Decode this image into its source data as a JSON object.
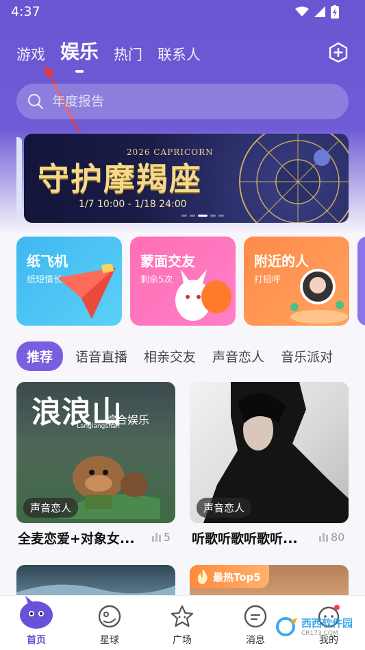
{
  "status": {
    "time": "4:37"
  },
  "topnav": {
    "tabs": [
      "游戏",
      "娱乐",
      "热门",
      "联系人"
    ],
    "active": 1
  },
  "search": {
    "placeholder": "年度报告"
  },
  "banner": {
    "title": "守护摩羯座",
    "subtitle": "2026 CAPRICORN",
    "dates": "1/7 10:00  -  1/18 24:00"
  },
  "feature_cards": [
    {
      "title": "纸飞机",
      "subtitle": "纸短情长",
      "color": "#3fb8f0"
    },
    {
      "title": "蒙面交友",
      "subtitle": "剩余5次",
      "color": "#ff6fb5"
    },
    {
      "title": "附近的人",
      "subtitle": "打招呼",
      "color": "#ff8a4a"
    }
  ],
  "categories": [
    "推荐",
    "语音直播",
    "相亲交友",
    "声音恋人",
    "音乐派对"
  ],
  "rooms": [
    {
      "cover_text": "浪浪山",
      "cover_sub": "综合娱乐",
      "cover_en": "Langlangshan",
      "tag": "声音恋人",
      "title": "全麦恋爱+对象女...",
      "count": "5"
    },
    {
      "tag": "声音恋人",
      "title": "听歌听歌听歌听...",
      "count": "80"
    }
  ],
  "row2": {
    "top_tag": "最热Top5"
  },
  "bottom_nav": [
    "首页",
    "星球",
    "广场",
    "消息",
    "我的"
  ],
  "watermark": {
    "text": "西西软件园",
    "sub": "CR173.COM"
  },
  "colors": {
    "accent": "#6a52d8",
    "header": "#6a56d1"
  }
}
